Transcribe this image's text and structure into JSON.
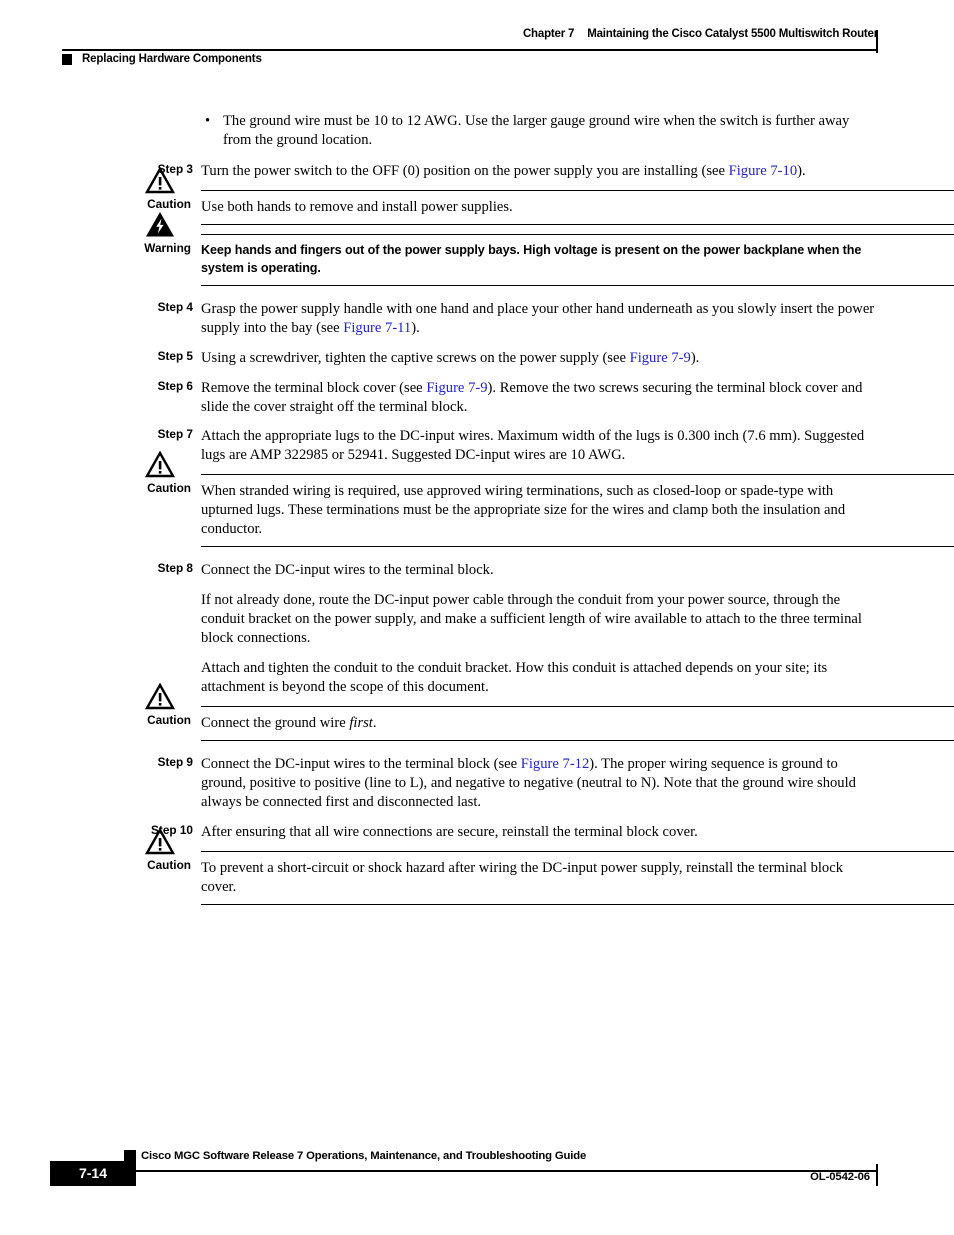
{
  "header": {
    "chapter_label": "Chapter 7",
    "chapter_title": "Maintaining the Cisco Catalyst 5500 Multiswitch Router",
    "section_title": "Replacing Hardware Components"
  },
  "icons": {
    "caution": "caution-triangle-icon",
    "warning": "warning-lightning-triangle-icon"
  },
  "colors": {
    "link": "#2222cc",
    "text": "#000000",
    "background": "#ffffff"
  },
  "blocks": [
    {
      "type": "bullet",
      "bullet": "•",
      "text": "The ground wire must be 10 to 12 AWG. Use the larger gauge ground wire when the switch is further away from the ground location."
    },
    {
      "type": "step",
      "label": "Step 3",
      "text_before": "Turn the power switch to the OFF (0) position on the power supply you are installing (see ",
      "link": "Figure 7-10",
      "text_after": ")."
    },
    {
      "type": "caution",
      "label": "Caution",
      "text": "Use both hands to remove and install power supplies."
    },
    {
      "type": "warning",
      "label": "Warning",
      "text": "Keep hands and fingers out of the power supply bays. High voltage is present on the power backplane when the system is operating."
    },
    {
      "type": "step",
      "label": "Step 4",
      "text_before": "Grasp the power supply handle with one hand and place your other hand underneath as you slowly insert the power supply into the bay (see ",
      "link": "Figure 7-11",
      "text_after": ")."
    },
    {
      "type": "step",
      "label": "Step 5",
      "text_before": "Using a screwdriver, tighten the captive screws on the power supply (see ",
      "link": "Figure 7-9",
      "text_after": ")."
    },
    {
      "type": "step",
      "label": "Step 6",
      "text_before": "Remove the terminal block cover (see ",
      "link": "Figure 7-9",
      "text_after": "). Remove the two screws securing the terminal block cover and slide the cover straight off the terminal block."
    },
    {
      "type": "step",
      "label": "Step 7",
      "text": "Attach the appropriate lugs to the DC-input wires. Maximum width of the lugs is 0.300 inch (7.6 mm). Suggested lugs are AMP 322985 or 52941. Suggested DC-input wires are 10 AWG."
    },
    {
      "type": "caution",
      "label": "Caution",
      "text": "When stranded wiring is required, use approved wiring terminations, such as closed-loop or spade-type with upturned lugs. These terminations must be the appropriate size for the wires and clamp both the insulation and conductor."
    },
    {
      "type": "step",
      "label": "Step 8",
      "text": "Connect the DC-input wires to the terminal block."
    },
    {
      "type": "para",
      "text": "If not already done, route the DC-input power cable through the conduit from your power source, through the conduit bracket on the power supply, and make a sufficient length of wire available to attach to the three terminal block connections."
    },
    {
      "type": "para",
      "text": "Attach and tighten the conduit to the conduit bracket. How this conduit is attached depends on your site; its attachment is beyond the scope of this document."
    },
    {
      "type": "caution",
      "label": "Caution",
      "text_before": "Connect the ground wire ",
      "italic": "first",
      "text_after": "."
    },
    {
      "type": "step",
      "label": "Step 9",
      "text_before": "Connect the DC-input wires to the terminal block (see ",
      "link": "Figure 7-12",
      "text_after": "). The proper wiring sequence is ground to ground, positive to positive (line to L), and negative to negative (neutral to N). Note that the ground wire should always be connected first and disconnected last."
    },
    {
      "type": "step",
      "label": "Step 10",
      "text": "After ensuring that all wire connections are secure, reinstall the terminal block cover."
    },
    {
      "type": "caution",
      "label": "Caution",
      "text": "To prevent a short-circuit or shock hazard after wiring the DC-input power supply, reinstall the terminal block cover."
    }
  ],
  "footer": {
    "document_title": "Cisco MGC Software Release 7 Operations, Maintenance, and Troubleshooting Guide",
    "page_number": "7-14",
    "doc_id": "OL-0542-06"
  }
}
